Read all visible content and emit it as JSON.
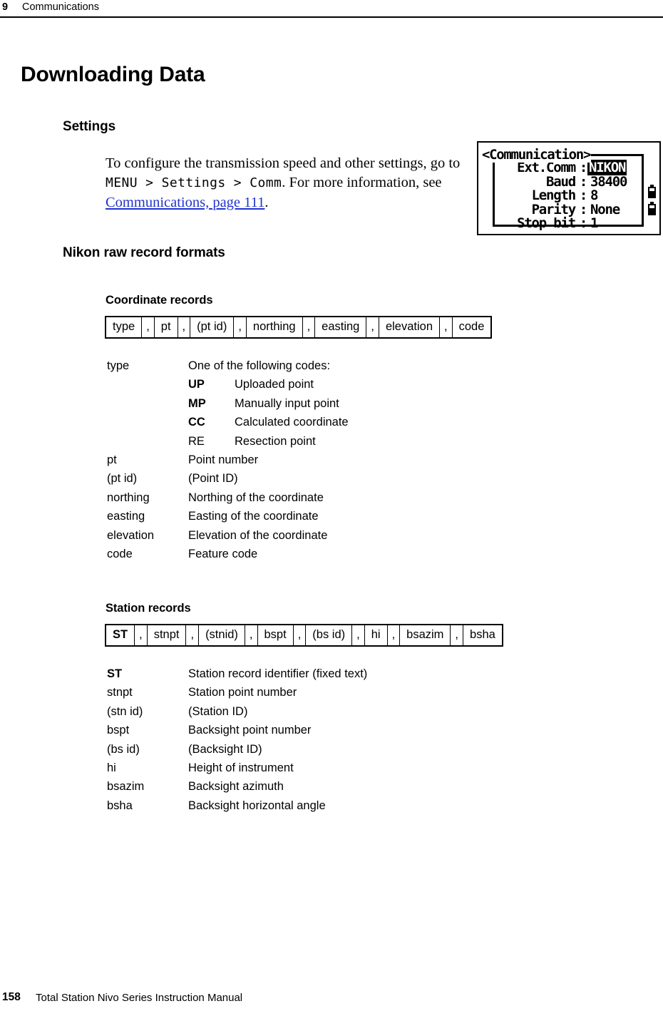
{
  "header": {
    "chapter_number": "9",
    "chapter_title": "Communications"
  },
  "page_title": "Downloading Data",
  "sections": {
    "settings": {
      "heading": "Settings",
      "paragraph_part1": "To configure the transmission speed and other settings, go to ",
      "menu_path": "MENU > Settings > Comm",
      "paragraph_part2": ". For more information, see ",
      "link_text": "Communications, page 111",
      "paragraph_part3": ".",
      "link_color": "#2233cc"
    },
    "formats": {
      "heading": "Nikon raw record formats"
    },
    "coordinate_records": {
      "heading": "Coordinate records",
      "fields": [
        "type",
        "pt",
        "(pt id)",
        "northing",
        "easting",
        "elevation",
        "code"
      ],
      "separator": ",",
      "definitions": [
        {
          "term": "type",
          "bold": false,
          "desc": "One of the following codes:"
        },
        {
          "term": "pt",
          "bold": false,
          "desc": "Point number"
        },
        {
          "term": "(pt id)",
          "bold": false,
          "desc": "(Point ID)"
        },
        {
          "term": "northing",
          "bold": false,
          "desc": "Northing of the coordinate"
        },
        {
          "term": "easting",
          "bold": false,
          "desc": "Easting of the coordinate"
        },
        {
          "term": "elevation",
          "bold": false,
          "desc": "Elevation of the coordinate"
        },
        {
          "term": "code",
          "bold": false,
          "desc": "Feature code"
        }
      ],
      "type_codes": [
        {
          "code": "UP",
          "bold": true,
          "desc": "Uploaded point"
        },
        {
          "code": "MP",
          "bold": true,
          "desc": "Manually input point"
        },
        {
          "code": "CC",
          "bold": true,
          "desc": "Calculated coordinate"
        },
        {
          "code": "RE",
          "bold": false,
          "desc": "Resection point"
        }
      ]
    },
    "station_records": {
      "heading": "Station records",
      "fields": [
        "ST",
        "stnpt",
        "(stnid)",
        "bspt",
        "(bs id)",
        "hi",
        "bsazim",
        "bsha"
      ],
      "first_field_bold": true,
      "separator": ",",
      "definitions": [
        {
          "term": "ST",
          "bold": true,
          "desc": "Station record identifier (fixed text)"
        },
        {
          "term": "stnpt",
          "bold": false,
          "desc": "Station point number"
        },
        {
          "term": "(stn id)",
          "bold": false,
          "desc": "(Station ID)"
        },
        {
          "term": "bspt",
          "bold": false,
          "desc": "Backsight point number"
        },
        {
          "term": "(bs id)",
          "bold": false,
          "desc": "(Backsight ID)"
        },
        {
          "term": "hi",
          "bold": false,
          "desc": "Height of instrument"
        },
        {
          "term": "bsazim",
          "bold": false,
          "desc": "Backsight azimuth"
        },
        {
          "term": "bsha",
          "bold": false,
          "desc": "Backsight horizontal angle"
        }
      ]
    }
  },
  "lcd_screen": {
    "title": "<Communication>",
    "rows": [
      {
        "label": "Ext.Comm",
        "colon": ":",
        "value": "NIKON",
        "highlighted": true
      },
      {
        "label": "Baud",
        "colon": ":",
        "value": "38400",
        "highlighted": false
      },
      {
        "label": "Length",
        "colon": ":",
        "value": "8",
        "highlighted": false
      },
      {
        "label": "Parity",
        "colon": ":",
        "value": "None",
        "highlighted": false
      },
      {
        "label": "Stop bit",
        "colon": ":",
        "value": "1",
        "highlighted": false
      }
    ],
    "icons": [
      "battery-icon",
      "battery-icon"
    ]
  },
  "footer": {
    "page_number": "158",
    "manual_title": "Total Station Nivo Series Instruction Manual"
  }
}
